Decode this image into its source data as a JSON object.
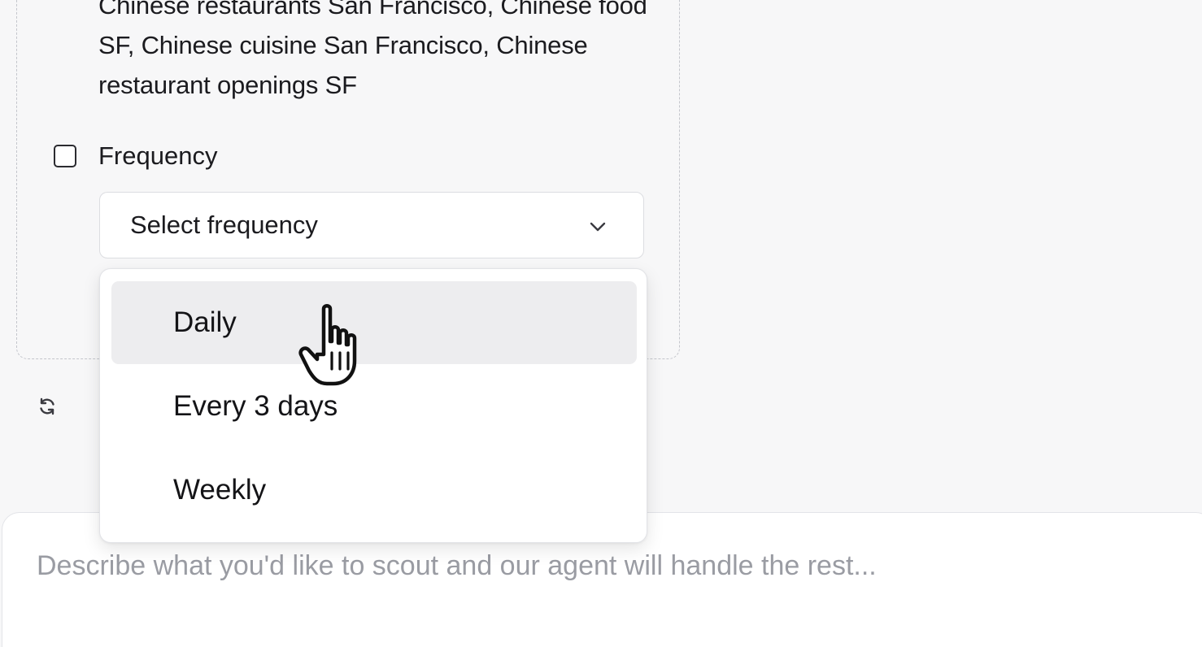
{
  "filters": {
    "keywords_text": "Chinese restaurants San Francisco, Chinese food SF, Chinese cuisine San Francisco, Chinese restaurant openings SF",
    "frequency": {
      "label": "Frequency",
      "checked": false,
      "select_value": "Select frequency",
      "options": [
        {
          "label": "Daily",
          "highlighted": true
        },
        {
          "label": "Every 3 days",
          "highlighted": false
        },
        {
          "label": "Weekly",
          "highlighted": false
        }
      ]
    }
  },
  "icons": {
    "refresh": "refresh-icon",
    "chevron": "chevron-down-icon",
    "cursor": "hand-pointer-cursor"
  },
  "composer": {
    "placeholder": "Describe what you'd like to scout and our agent will handle the rest...",
    "value": ""
  },
  "colors": {
    "background": "#f7f7f8",
    "highlight": "#ededef",
    "placeholder": "#9a9ca3",
    "text": "#1b1b1f"
  }
}
